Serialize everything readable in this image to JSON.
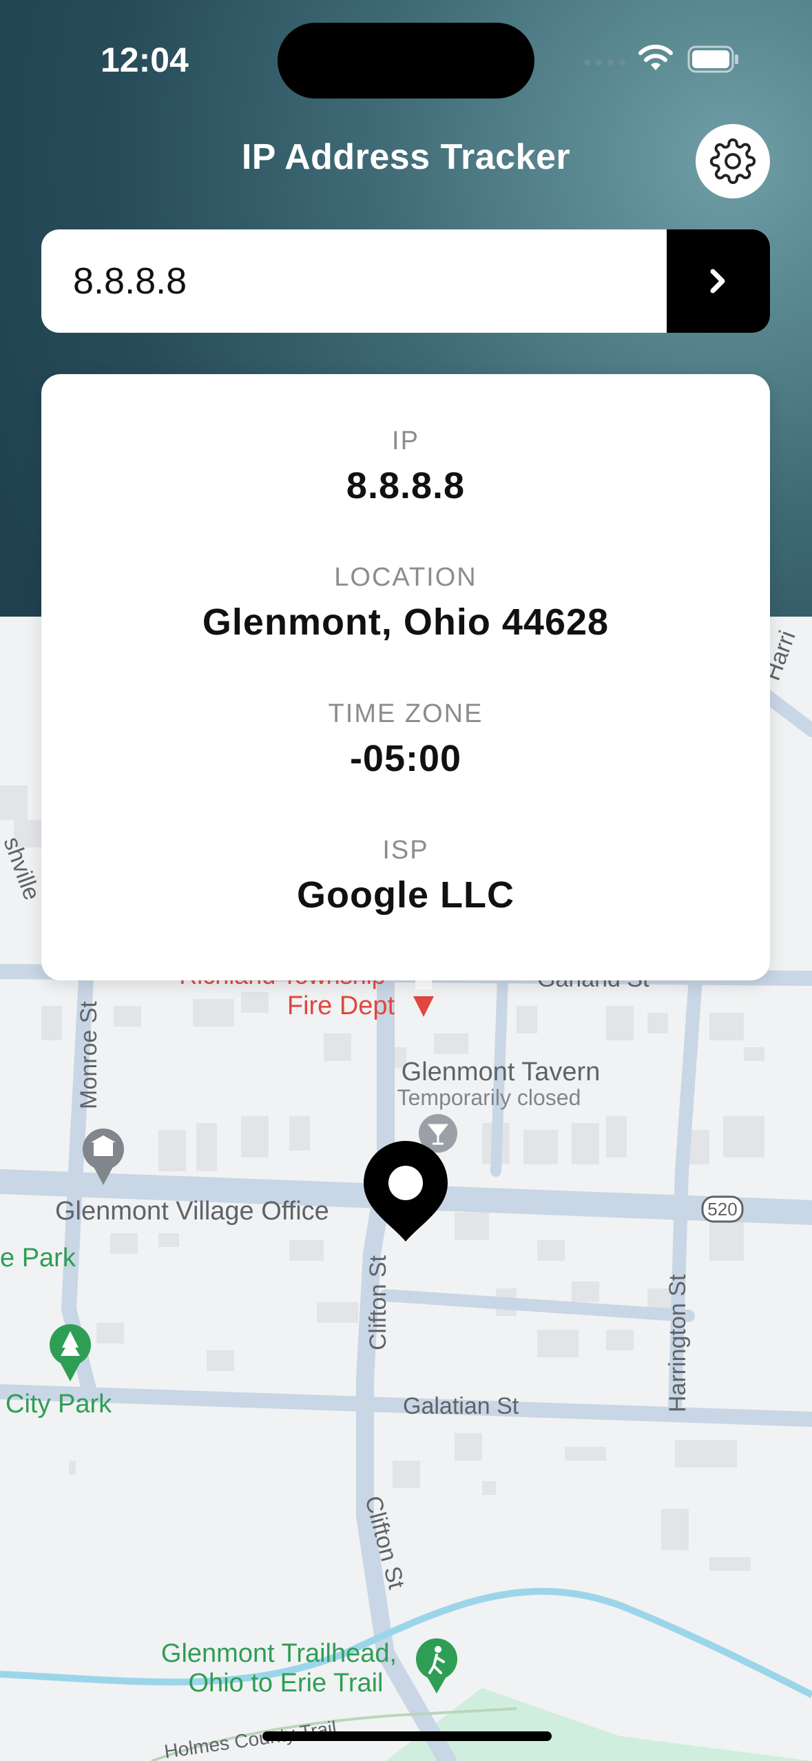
{
  "status_bar": {
    "time": "12:04"
  },
  "header": {
    "title": "IP Address Tracker"
  },
  "search": {
    "value": "8.8.8.8",
    "placeholder": ""
  },
  "info": [
    {
      "label": "IP",
      "value": "8.8.8.8"
    },
    {
      "label": "LOCATION",
      "value": "Glenmont, Ohio 44628"
    },
    {
      "label": "TIME ZONE",
      "value": "-05:00"
    },
    {
      "label": "ISP",
      "value": "Google LLC"
    }
  ],
  "map": {
    "streets": {
      "monroe": "Monroe St",
      "clifton": "Clifton St",
      "clifton_south": "Clifton St",
      "harrington": "Harrington St",
      "galatian": "Galatian St",
      "garland": "Garland St",
      "holmes_trail": "Holmes County Trail",
      "harrington_top": "Harri"
    },
    "pois": {
      "fire_dept_line1": "Richland Township",
      "fire_dept_line2": "Fire Dept",
      "tavern_name": "Glenmont Tavern",
      "tavern_status": "Temporarily closed",
      "village_office": "Glenmont Village Office",
      "park_left": "e Park",
      "city_park": "City Park",
      "trailhead_line1": "Glenmont Trailhead,",
      "trailhead_line2": "Ohio to Erie Trail",
      "nashville_fragment": "shville"
    },
    "route_shield": "520"
  },
  "colors": {
    "header_gradient_light": "#6f9ea6",
    "header_gradient_dark": "#1f414e",
    "map_background": "#f1f2f3",
    "road": "#c8d6e5",
    "water": "#9bd5ea",
    "poi_red": "#e0473f",
    "park_green": "#2e9e55"
  }
}
